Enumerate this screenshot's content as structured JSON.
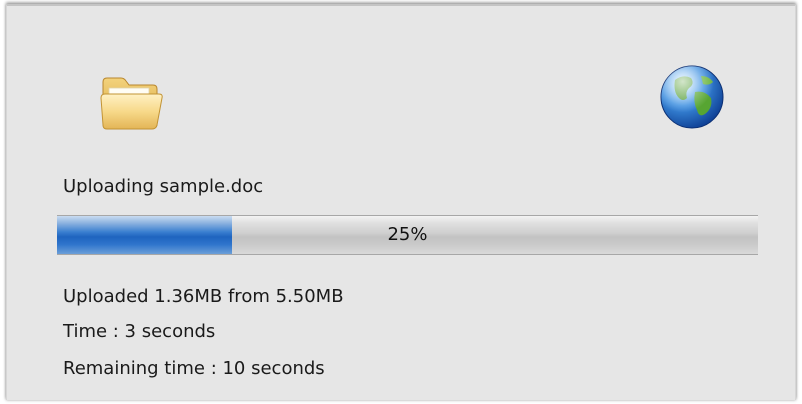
{
  "dialog": {
    "icons": {
      "left": "folder-icon",
      "right": "globe-icon"
    },
    "status_text": "Uploading sample.doc",
    "progress": {
      "value": 25,
      "label": "25%"
    },
    "uploaded_text": "Uploaded 1.36MB from 5.50MB",
    "time_text": "Time : 3 seconds",
    "remaining_text": "Remaining time : 10 seconds"
  },
  "colors": {
    "background": "#e6e6e6",
    "progress_fill": "#2f75cc",
    "progress_track": "#cfcfcf"
  }
}
